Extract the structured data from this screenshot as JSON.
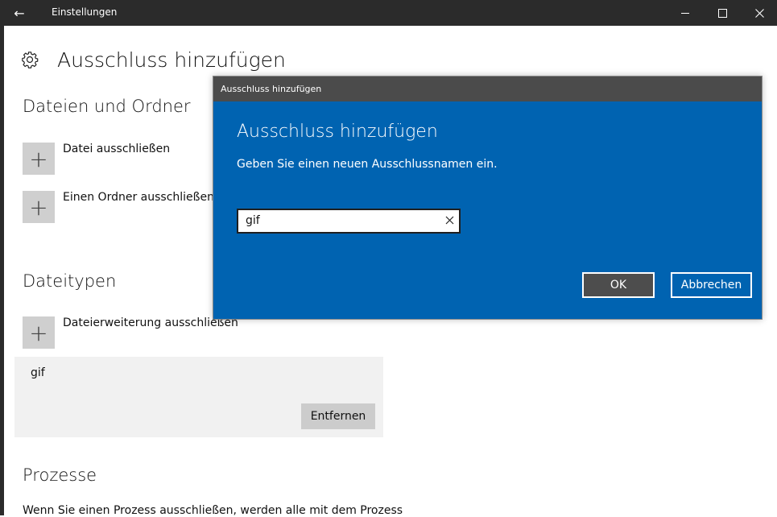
{
  "window": {
    "title": "Einstellungen",
    "controls": [
      "minimize-icon",
      "maximize-icon",
      "close-icon"
    ]
  },
  "page": {
    "title": "Ausschluss hinzufügen",
    "icon": "gear-icon"
  },
  "sections": {
    "files_folders": {
      "title": "Dateien und Ordner",
      "add_file_label": "Datei ausschließen",
      "add_folder_label": "Einen Ordner ausschließen"
    },
    "file_types": {
      "title": "Dateitypen",
      "add_extension_label": "Dateierweiterung ausschließen",
      "entries": [
        {
          "name": "gif",
          "remove_label": "Entfernen"
        }
      ]
    },
    "processes": {
      "title": "Prozesse",
      "description": "Wenn Sie einen Prozess ausschließen, werden alle mit dem Prozess"
    }
  },
  "dialog": {
    "window_title": "Ausschluss hinzufügen",
    "heading": "Ausschluss hinzufügen",
    "prompt": "Geben Sie einen neuen Ausschlussnamen ein.",
    "input_value": "gif",
    "ok_label": "OK",
    "cancel_label": "Abbrechen"
  },
  "colors": {
    "titlebar": "#2b2b2b",
    "dialog_bg": "#0063b1",
    "dialog_titlebar": "#4b4b4b",
    "add_button": "#cfcfcf",
    "card_bg": "#f1f1f1"
  }
}
